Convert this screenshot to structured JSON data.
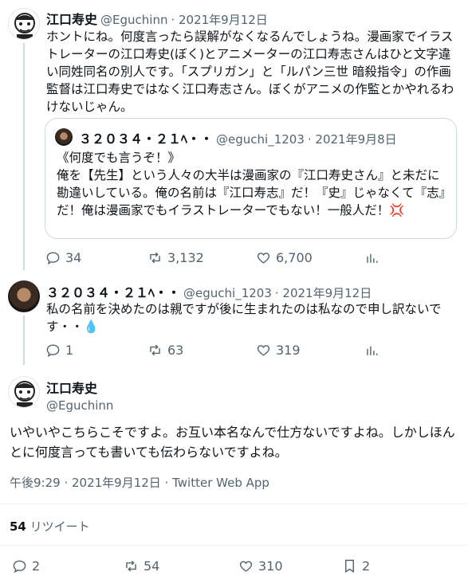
{
  "tweet1": {
    "name": "江口寿史",
    "handle": "@Eguchinn",
    "date": "· 2021年9月12日",
    "text": "ホントにね。何度言ったら誤解がなくなるんでしょうね。漫画家でイラストレーターの江口寿史(ぼく)とアニメーターの江口寿志さんはひと文字違い同姓同名の別人です。「スプリガン」と「ルパン三世 暗殺指令」の作画監督は江口寿史ではなく江口寿志さん。ぼくがアニメの作監とかやれるわけないじゃん。",
    "quote": {
      "name": "３２０３４・２１ﾍ・・",
      "handle": "@eguchi_1203",
      "date": "· 2021年9月8日",
      "text": "《何度でも言うぞ！》\n俺を【先生】という人々の大半は漫画家の『江口寿史さん』と未だに勘違いしている。俺の名前は『江口寿志』だ！『史』じゃなくて『志』だ！俺は漫画家でもイラストレーターでもない！一般人だ！💢"
    },
    "replies": "34",
    "retweets": "3,132",
    "likes": "6,700"
  },
  "tweet2": {
    "name": "３２０３４・２１ﾍ・・",
    "handle": "@eguchi_1203",
    "date": "· 2021年9月12日",
    "text": "私の名前を決めたのは親ですが後に生まれたのは私なので申し訳ないです・・💧",
    "replies": "1",
    "retweets": "63",
    "likes": "319"
  },
  "main": {
    "name": "江口寿史",
    "handle": "@Eguchinn",
    "text": "いやいやこちらこそですよ。お互い本名なんで仕方ないですよね。しかしほんとに何度言っても書いても伝わらないですよね。",
    "time": "午後9:29 · 2021年9月12日 · ",
    "client": "Twitter Web App",
    "retweet_count": "54",
    "retweet_label": "リツイート",
    "replies": "2",
    "retweets": "54",
    "likes": "310",
    "bookmarks": "2"
  },
  "icons": [
    "reply-icon",
    "retweet-icon",
    "like-icon",
    "analytics-icon",
    "bookmark-icon"
  ]
}
